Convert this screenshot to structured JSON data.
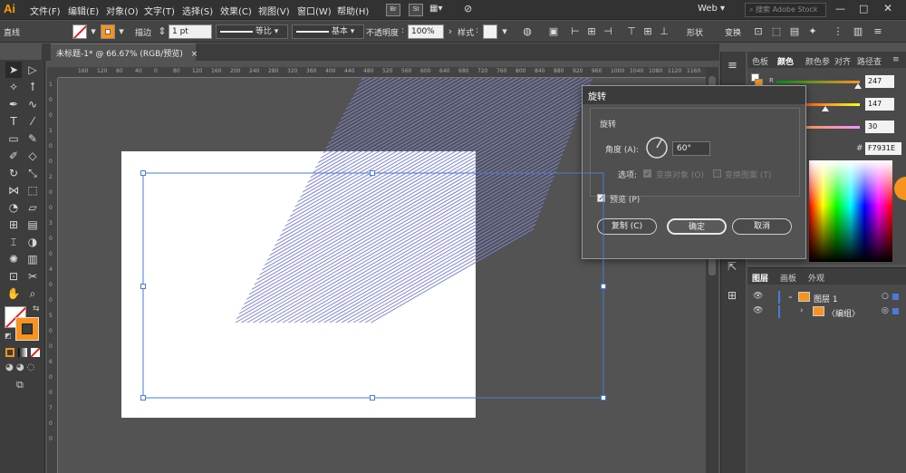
{
  "app": {
    "logo": "Ai"
  },
  "menu": [
    "文件(F)",
    "编辑(E)",
    "对象(O)",
    "文字(T)",
    "选择(S)",
    "效果(C)",
    "视图(V)",
    "窗口(W)",
    "帮助(H)"
  ],
  "menu_mini": [
    "Br",
    "St"
  ],
  "workspace": {
    "label": "Web",
    "search_placeholder": "搜索 Adobe Stock"
  },
  "control_bar": {
    "selection_type": "直线",
    "stroke_label": "描边",
    "stroke_value": "1 pt",
    "profile1": "等比",
    "profile2": "基本",
    "opacity_label": "不透明度",
    "opacity_value": "100%",
    "style_label": "样式",
    "shape_label": "形状",
    "transform_label": "变换",
    "fill_color": "#ffffff",
    "stroke_color": "#f7931e"
  },
  "document": {
    "tab": "未标题-1* @ 66.67% (RGB/预览)",
    "close": "×"
  },
  "rulers": {
    "top": [
      "160",
      "120",
      "80",
      "40",
      "0",
      "80",
      "120",
      "160",
      "200",
      "240",
      "280",
      "320",
      "360",
      "400",
      "440",
      "480",
      "520",
      "560",
      "600",
      "640",
      "680",
      "720",
      "760",
      "800",
      "840",
      "880",
      "920",
      "960",
      "1000",
      "1040",
      "1080",
      "1120",
      "1160",
      "1200"
    ],
    "left": [
      "1",
      "0",
      "0",
      "1",
      "0",
      "0",
      "2",
      "0",
      "0",
      "3",
      "0",
      "0",
      "4",
      "0",
      "0",
      "5",
      "0",
      "0",
      "6",
      "0",
      "0",
      "7",
      "0",
      "0"
    ]
  },
  "color_panel": {
    "tabs": [
      "色板",
      "颜色",
      "颜色参",
      "对齐",
      "路径查"
    ],
    "sliders": [
      {
        "channel": "R",
        "value": "247",
        "color": "#f7931e",
        "fraction": 0.97
      },
      {
        "channel": "G",
        "value": "147",
        "color": "#f7931e",
        "fraction": 0.58
      },
      {
        "channel": "B",
        "value": "30",
        "color": "#f7931e",
        "fraction": 0.12
      }
    ],
    "hex_label": "#",
    "hex": "F7931E"
  },
  "layers_panel": {
    "tabs": [
      "图层",
      "画板",
      "外观"
    ],
    "layers": [
      {
        "name": "图层 1"
      },
      {
        "name": "〈编组〉"
      }
    ]
  },
  "dialog": {
    "title": "旋转",
    "section": "旋转",
    "angle_label": "角度 (A):",
    "angle_value": "60°",
    "options_label": "选项:",
    "transform_objects": "变换对象 (O)",
    "transform_patterns": "变换图案 (T)",
    "preview_label": "预览 (P)",
    "preview_checked": true,
    "copy_button": "复制 (C)",
    "ok_button": "确定",
    "cancel_button": "取消"
  },
  "accent_color": "#f7931e",
  "pattern_color": "#6b86d4"
}
